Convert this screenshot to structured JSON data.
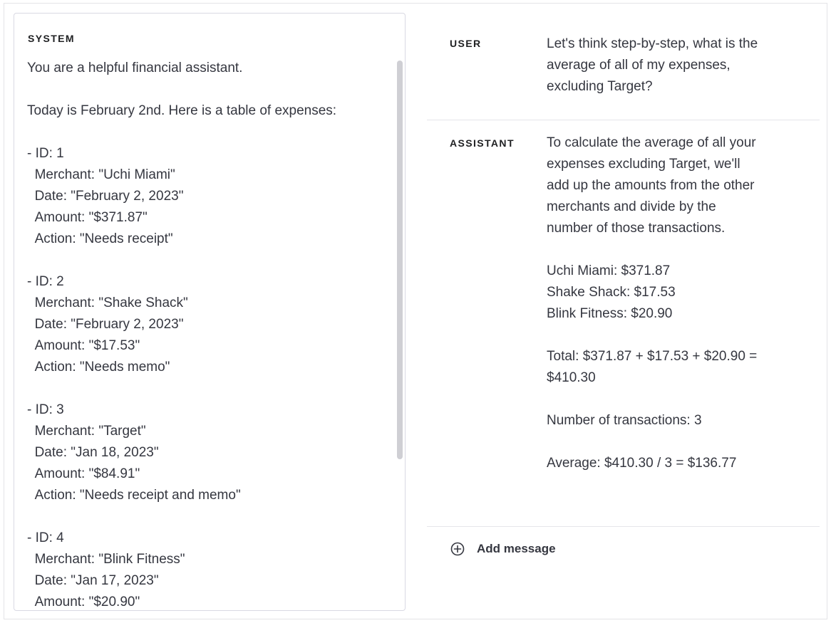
{
  "system": {
    "label": "SYSTEM",
    "content": "You are a helpful financial assistant.\n\nToday is February 2nd. Here is a table of expenses:\n\n- ID: 1\n  Merchant: \"Uchi Miami\"\n  Date: \"February 2, 2023\"\n  Amount: \"$371.87\"\n  Action: \"Needs receipt\"\n\n- ID: 2\n  Merchant: \"Shake Shack\"\n  Date: \"February 2, 2023\"\n  Amount: \"$17.53\"\n  Action: \"Needs memo\"\n\n- ID: 3\n  Merchant: \"Target\"\n  Date: \"Jan 18, 2023\"\n  Amount: \"$84.91\"\n  Action: \"Needs receipt and memo\"\n\n- ID: 4\n  Merchant: \"Blink Fitness\"\n  Date: \"Jan 17, 2023\"\n  Amount: \"$20.90\""
  },
  "messages": [
    {
      "role": "USER",
      "content": "Let's think step-by-step, what is the average of all of my expenses, excluding Target?"
    },
    {
      "role": "ASSISTANT",
      "content": "To calculate the average of all your expenses excluding Target, we'll add up the amounts from the other merchants and divide by the number of those transactions.\n\nUchi Miami: $371.87\nShake Shack: $17.53\nBlink Fitness: $20.90\n\nTotal: $371.87 + $17.53 + $20.90 = $410.30\n\nNumber of transactions: 3\n\nAverage: $410.30 / 3 = $136.77"
    }
  ],
  "add_message": {
    "label": "Add message",
    "icon": "plus-circle-icon"
  }
}
